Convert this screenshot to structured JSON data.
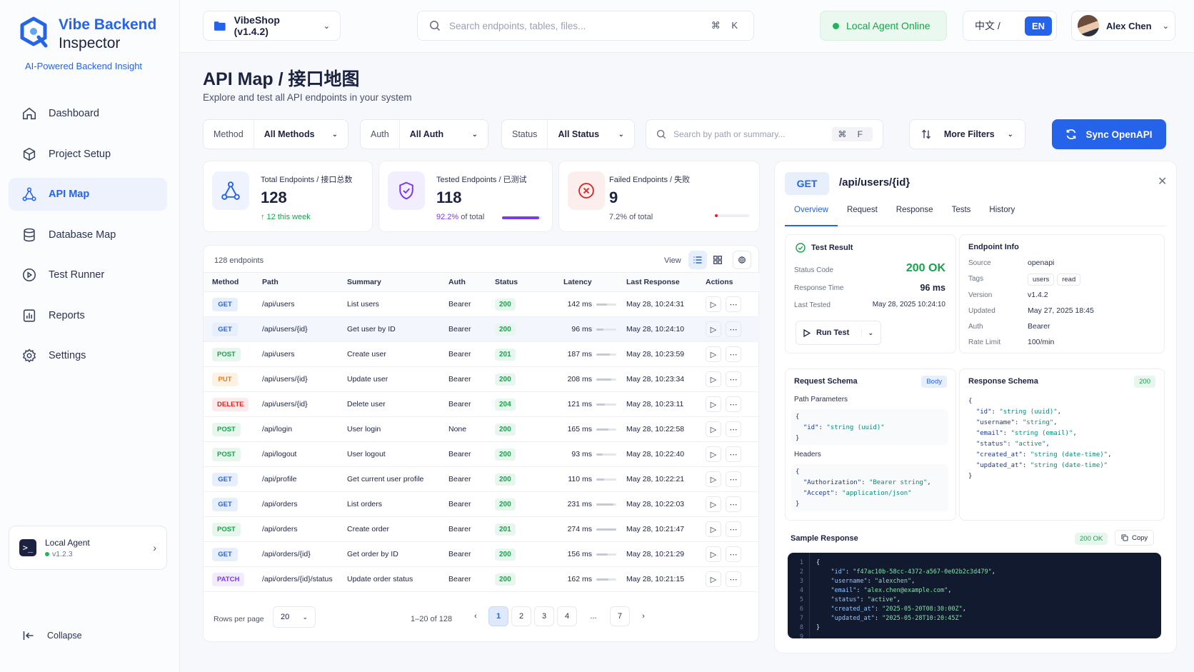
{
  "brand": {
    "name_line1": "Vibe Backend",
    "name_line2": "Inspector",
    "tagline": "AI-Powered Backend Insight"
  },
  "nav": [
    {
      "label": "Dashboard",
      "icon": "home-icon"
    },
    {
      "label": "Project Setup",
      "icon": "cube-icon"
    },
    {
      "label": "API Map",
      "icon": "network-icon",
      "active": true
    },
    {
      "label": "Database Map",
      "icon": "database-icon"
    },
    {
      "label": "Test Runner",
      "icon": "play-circle-icon"
    },
    {
      "label": "Reports",
      "icon": "bar-chart-icon"
    },
    {
      "label": "Settings",
      "icon": "gear-icon"
    }
  ],
  "agent": {
    "name": "Local Agent",
    "version": "v1.2.3"
  },
  "collapse_label": "Collapse",
  "topbar": {
    "project": "VibeShop (v1.4.2)",
    "search_placeholder": "Search endpoints, tables, files...",
    "search_shortcut": "⌘ K",
    "agent_status": "Local Agent Online",
    "lang_zh": "中文 /",
    "lang_en": "EN",
    "user": "Alex Chen"
  },
  "page": {
    "title": "API Map / 接口地图",
    "subtitle": "Explore and test all API endpoints in your system"
  },
  "filters": {
    "method_label": "Method",
    "method_value": "All Methods",
    "auth_label": "Auth",
    "auth_value": "All Auth",
    "status_label": "Status",
    "status_value": "All Status",
    "search_placeholder": "Search by path or summary...",
    "search_shortcut": "⌘ F",
    "more": "More Filters",
    "sync": "Sync OpenAPI"
  },
  "stats": {
    "total": {
      "label": "Total Endpoints / 接口总数",
      "value": "128",
      "sub": "↑ 12 this week"
    },
    "tested": {
      "label": "Tested Endpoints / 已测试",
      "value": "118",
      "sub": "92.2%",
      "sub_suffix": "of total",
      "progress": 0.922
    },
    "failed": {
      "label": "Failed Endpoints / 失败",
      "value": "9",
      "sub": "7.2% of total",
      "progress": 0.072
    }
  },
  "table": {
    "count": "128 endpoints",
    "view_label": "View",
    "headers": [
      "Method",
      "Path",
      "Summary",
      "Auth",
      "Status",
      "Latency",
      "Last Response",
      "Actions"
    ],
    "rows": [
      {
        "method": "GET",
        "path": "/api/users",
        "summary": "List users",
        "auth": "Bearer",
        "status": "200",
        "latency": "142 ms",
        "latency_ms": 142,
        "last": "May 28, 10:24:31"
      },
      {
        "method": "GET",
        "path": "/api/users/{id}",
        "summary": "Get user by ID",
        "auth": "Bearer",
        "status": "200",
        "latency": "96 ms",
        "latency_ms": 96,
        "last": "May 28, 10:24:10",
        "selected": true
      },
      {
        "method": "POST",
        "path": "/api/users",
        "summary": "Create user",
        "auth": "Bearer",
        "status": "201",
        "latency": "187 ms",
        "latency_ms": 187,
        "last": "May 28, 10:23:59"
      },
      {
        "method": "PUT",
        "path": "/api/users/{id}",
        "summary": "Update user",
        "auth": "Bearer",
        "status": "200",
        "latency": "208 ms",
        "latency_ms": 208,
        "last": "May 28, 10:23:34"
      },
      {
        "method": "DELETE",
        "path": "/api/users/{id}",
        "summary": "Delete user",
        "auth": "Bearer",
        "status": "204",
        "latency": "121 ms",
        "latency_ms": 121,
        "last": "May 28, 10:23:11"
      },
      {
        "method": "POST",
        "path": "/api/login",
        "summary": "User login",
        "auth": "None",
        "status": "200",
        "latency": "165 ms",
        "latency_ms": 165,
        "last": "May 28, 10:22:58"
      },
      {
        "method": "POST",
        "path": "/api/logout",
        "summary": "User logout",
        "auth": "Bearer",
        "status": "200",
        "latency": "93 ms",
        "latency_ms": 93,
        "last": "May 28, 10:22:40"
      },
      {
        "method": "GET",
        "path": "/api/profile",
        "summary": "Get current user profile",
        "auth": "Bearer",
        "status": "200",
        "latency": "110 ms",
        "latency_ms": 110,
        "last": "May 28, 10:22:21"
      },
      {
        "method": "GET",
        "path": "/api/orders",
        "summary": "List orders",
        "auth": "Bearer",
        "status": "200",
        "latency": "231 ms",
        "latency_ms": 231,
        "last": "May 28, 10:22:03"
      },
      {
        "method": "POST",
        "path": "/api/orders",
        "summary": "Create order",
        "auth": "Bearer",
        "status": "201",
        "latency": "274 ms",
        "latency_ms": 274,
        "last": "May 28, 10:21:47"
      },
      {
        "method": "GET",
        "path": "/api/orders/{id}",
        "summary": "Get order by ID",
        "auth": "Bearer",
        "status": "200",
        "latency": "156 ms",
        "latency_ms": 156,
        "last": "May 28, 10:21:29"
      },
      {
        "method": "PATCH",
        "path": "/api/orders/{id}/status",
        "summary": "Update order status",
        "auth": "Bearer",
        "status": "200",
        "latency": "162 ms",
        "latency_ms": 162,
        "last": "May 28, 10:21:15"
      }
    ],
    "rows_per_page_label": "Rows per page",
    "rows_per_page": "20",
    "range": "1–20 of 128",
    "pages": [
      "1",
      "2",
      "3",
      "4",
      "...",
      "7"
    ]
  },
  "method_colors": {
    "GET": {
      "bg": "#e7effd",
      "fg": "#2563eb"
    },
    "POST": {
      "bg": "#e8f7ee",
      "fg": "#16a34a"
    },
    "PUT": {
      "bg": "#fdf1e4",
      "fg": "#ea7a18"
    },
    "DELETE": {
      "bg": "#fdeaea",
      "fg": "#dc2626"
    },
    "PATCH": {
      "bg": "#f1ebfd",
      "fg": "#7c3aed"
    }
  },
  "detail": {
    "method": "GET",
    "path": "/api/users/{id}",
    "tabs": [
      "Overview",
      "Request",
      "Response",
      "Tests",
      "History"
    ],
    "test_result": {
      "title": "Test Result",
      "status_code_label": "Status Code",
      "status_code": "200 OK",
      "response_time_label": "Response Time",
      "response_time": "96 ms",
      "last_tested_label": "Last Tested",
      "last_tested": "May 28, 2025 10:24:10",
      "run_test": "Run Test"
    },
    "info": {
      "title": "Endpoint Info",
      "source_label": "Source",
      "source": "openapi",
      "tags_label": "Tags",
      "tags": [
        "users",
        "read"
      ],
      "version_label": "Version",
      "version": "v1.4.2",
      "updated_label": "Updated",
      "updated": "May 27, 2025 18:45",
      "auth_label": "Auth",
      "auth": "Bearer",
      "rate_label": "Rate Limit",
      "rate": "100/min"
    },
    "request_schema": {
      "title": "Request Schema",
      "badge": "Body",
      "path_params_title": "Path Parameters",
      "path_params": [
        {
          "key": "\"id\"",
          "val": "\"string (uuid)\""
        }
      ],
      "headers_title": "Headers",
      "headers": [
        {
          "key": "\"Authorization\"",
          "val": "\"Bearer string\""
        },
        {
          "key": "\"Accept\"",
          "val": "\"application/json\""
        }
      ]
    },
    "response_schema": {
      "title": "Response Schema",
      "badge": "200",
      "fields": [
        {
          "key": "\"id\"",
          "val": "\"string (uuid)\""
        },
        {
          "key": "\"username\"",
          "val": "\"string\""
        },
        {
          "key": "\"email\"",
          "val": "\"string (email)\""
        },
        {
          "key": "\"status\"",
          "val": "\"active\""
        },
        {
          "key": "\"created_at\"",
          "val": "\"string (date-time)\""
        },
        {
          "key": "\"updated_at\"",
          "val": "\"string (date-time)\""
        }
      ]
    },
    "sample": {
      "title": "Sample Response",
      "badge": "200 OK",
      "copy": "Copy",
      "fields": [
        {
          "key": "\"id\"",
          "val": "\"f47ac10b-58cc-4372-a567-0e02b2c3d479\""
        },
        {
          "key": "\"username\"",
          "val": "\"alexchen\""
        },
        {
          "key": "\"email\"",
          "val": "\"alex.chen@example.com\""
        },
        {
          "key": "\"status\"",
          "val": "\"active\""
        },
        {
          "key": "\"created_at\"",
          "val": "\"2025-05-20T08:30:00Z\""
        },
        {
          "key": "\"updated_at\"",
          "val": "\"2025-05-28T10:20:45Z\""
        }
      ]
    }
  }
}
